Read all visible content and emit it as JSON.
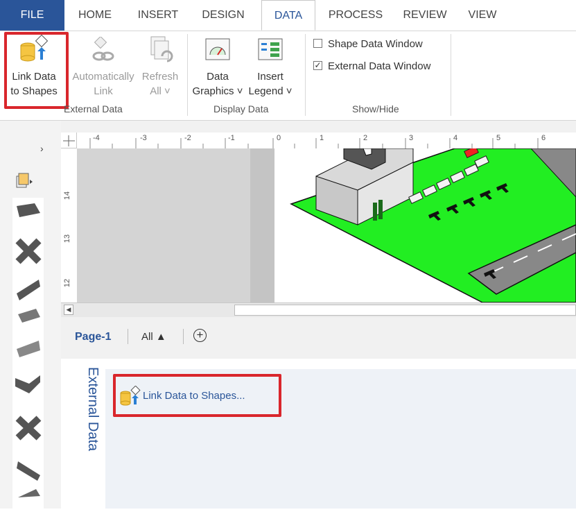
{
  "tabs": {
    "file": "FILE",
    "home": "HOME",
    "insert": "INSERT",
    "design": "DESIGN",
    "data": "DATA",
    "process": "PROCESS",
    "review": "REVIEW",
    "view": "VIEW"
  },
  "ribbon": {
    "link_data_line1": "Link Data",
    "link_data_line2": "to Shapes",
    "auto_link_line1": "Automatically",
    "auto_link_line2": "Link",
    "refresh_line1": "Refresh",
    "refresh_line2": "All ˅",
    "external_data_group": "External Data",
    "data_graphics_line1": "Data",
    "data_graphics_line2": "Graphics ˅",
    "insert_legend_line1": "Insert",
    "insert_legend_line2": "Legend ˅",
    "display_data_group": "Display Data",
    "shape_data_window": "Shape Data Window",
    "external_data_window": "External Data Window",
    "show_hide_group": "Show/Hide",
    "shape_data_checked": false,
    "external_data_checked": true
  },
  "ruler": {
    "h_ticks": [
      "-4",
      "-3",
      "-2",
      "-1",
      "0",
      "1",
      "2",
      "3",
      "4",
      "5",
      "6"
    ],
    "v_ticks": [
      "14",
      "13",
      "12"
    ]
  },
  "page_tabs": {
    "page1": "Page-1",
    "all": "All ▲",
    "add": "+"
  },
  "external_panel": {
    "title": "External Data",
    "link_button": "Link Data to Shapes..."
  },
  "colors": {
    "accent": "#2a5599",
    "highlight_red": "#d9262c",
    "grass": "#22ee22"
  }
}
